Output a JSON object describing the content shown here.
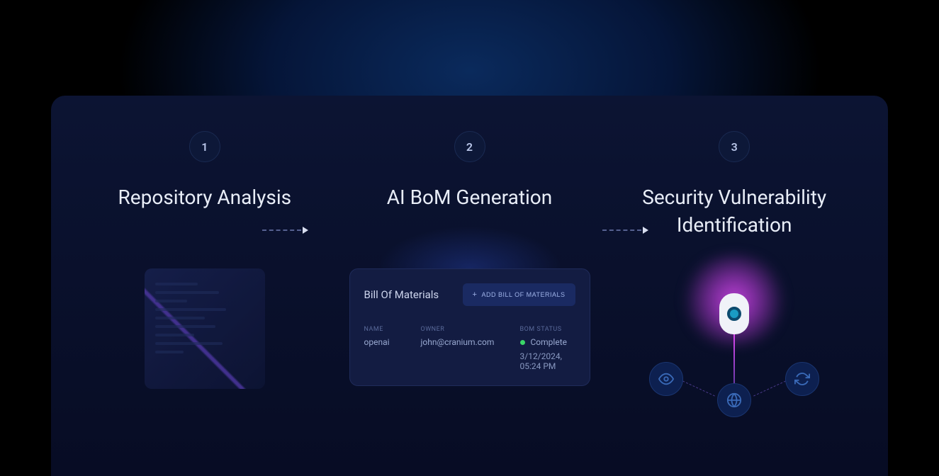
{
  "steps": [
    {
      "num": "1",
      "title": "Repository Analysis"
    },
    {
      "num": "2",
      "title": "AI BoM Generation"
    },
    {
      "num": "3",
      "title": "Security Vulnerability Identification"
    }
  ],
  "bom": {
    "card_title": "Bill Of Materials",
    "add_button": "ADD BILL OF MATERIALS",
    "labels": {
      "name": "NAME",
      "owner": "OWNER",
      "status": "BOM STATUS"
    },
    "name": "openai",
    "owner": "john@cranium.com",
    "status": "Complete",
    "timestamp": "3/12/2024, 05:24 PM"
  }
}
